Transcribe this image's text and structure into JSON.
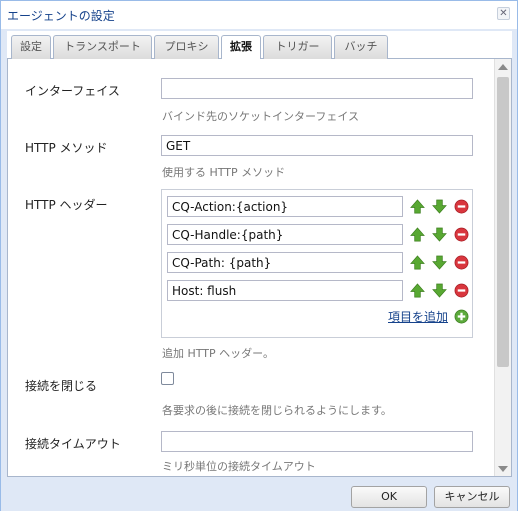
{
  "dialog": {
    "title": "エージェントの設定"
  },
  "tabs": [
    {
      "label": "設定"
    },
    {
      "label": "トランスポート"
    },
    {
      "label": "プロキシ"
    },
    {
      "label": "拡張"
    },
    {
      "label": "トリガー"
    },
    {
      "label": "バッチ"
    }
  ],
  "form": {
    "interface": {
      "label": "インターフェイス",
      "value": "",
      "help": "バインド先のソケットインターフェイス"
    },
    "http_method": {
      "label": "HTTP メソッド",
      "value": "GET",
      "help": "使用する HTTP メソッド"
    },
    "http_headers": {
      "label": "HTTP ヘッダー",
      "items": [
        "CQ-Action:{action}",
        "CQ-Handle:{path}",
        "CQ-Path: {path}",
        "Host: flush"
      ],
      "add_label": "項目を追加",
      "help": "追加 HTTP ヘッダー。"
    },
    "close_connection": {
      "label": "接続を閉じる",
      "checked": false,
      "help": "各要求の後に接続を閉じられるようにします。"
    },
    "connection_timeout": {
      "label": "接続タイムアウト",
      "value": "",
      "help": "ミリ秒単位の接続タイムアウト"
    }
  },
  "buttons": {
    "ok": "OK",
    "cancel": "キャンセル"
  },
  "colors": {
    "up_arrow": "#58a832",
    "down_arrow": "#58a832",
    "remove": "#d9363e",
    "add": "#5caa3c",
    "link": "#15428b"
  },
  "icons": {
    "move_up": "arrow-up-icon",
    "move_down": "arrow-down-icon",
    "remove": "remove-icon",
    "add": "add-icon",
    "close": "close-icon"
  }
}
